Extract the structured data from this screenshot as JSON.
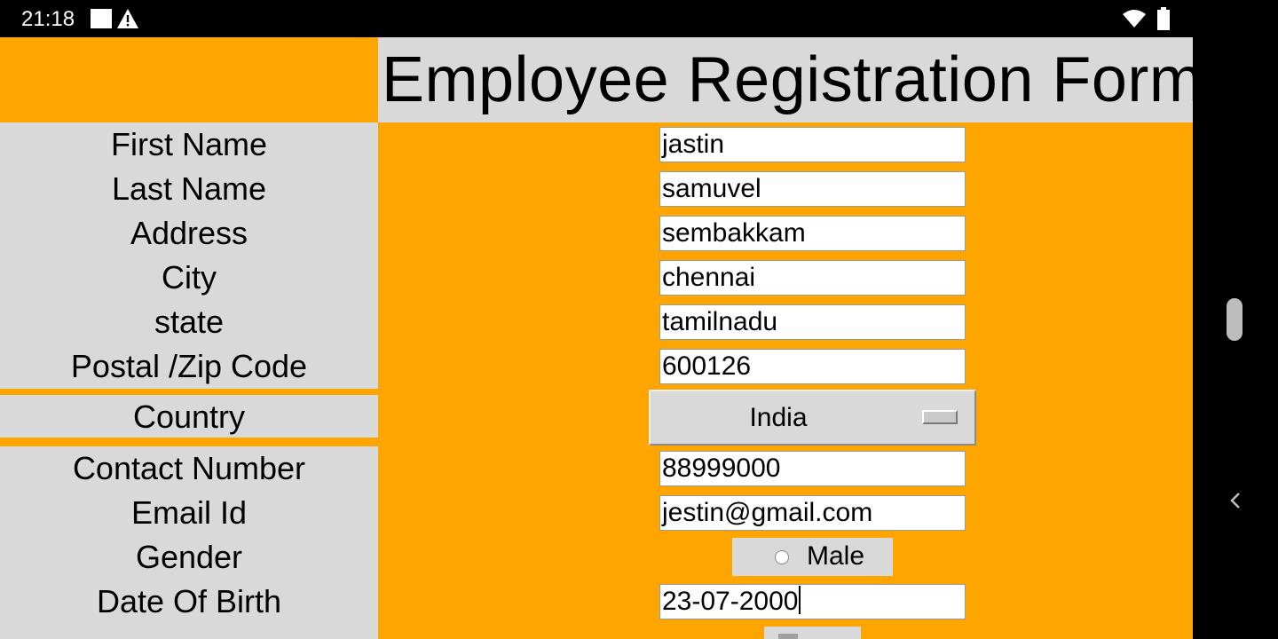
{
  "status_bar": {
    "time": "21:18",
    "icons": [
      "notification-square-icon",
      "alert-triangle-icon",
      "wifi-icon",
      "battery-icon"
    ]
  },
  "form": {
    "title": "Employee Registration Form",
    "labels": {
      "first_name": "First Name",
      "last_name": "Last Name",
      "address": "Address",
      "city": "City",
      "state": "state",
      "postal": "Postal /Zip Code",
      "country": "Country",
      "contact": "Contact Number",
      "email": "Email Id",
      "gender": "Gender",
      "dob": "Date Of Birth"
    },
    "values": {
      "first_name": "jastin",
      "last_name": "samuvel",
      "address": "sembakkam",
      "city": "chennai",
      "state": "tamilnadu",
      "postal": "600126",
      "country": "India",
      "contact": "88999000",
      "email": "jestin@gmail.com",
      "dob": "23-07-2000"
    },
    "gender_option": "Male"
  },
  "colors": {
    "accent_orange": "#ffa500",
    "panel_gray": "#d9d9d9"
  }
}
